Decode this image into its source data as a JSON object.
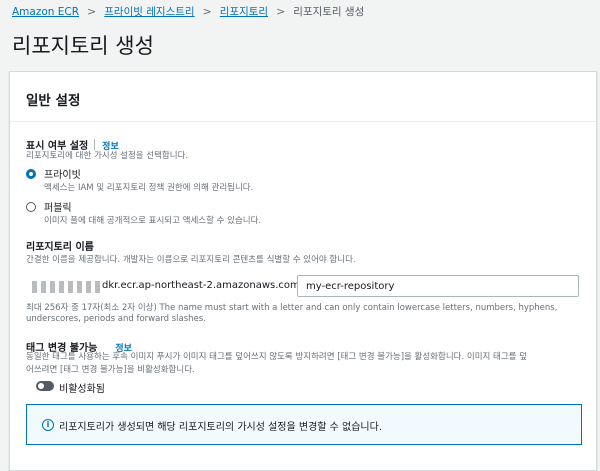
{
  "breadcrumbs": {
    "items": [
      "Amazon ECR",
      "프라이빗 레지스트리",
      "리포지토리"
    ],
    "separator": ">",
    "current": "리포지토리 생성"
  },
  "page": {
    "title": "리포지토리 생성"
  },
  "general": {
    "title": "일반 설정",
    "visibility": {
      "label": "표시 여부 설정",
      "info": "정보",
      "description": "리포지토리에 대한 가시성 설정을 선택합니다.",
      "options": [
        {
          "label": "프라이빗",
          "description": "액세스는 IAM 및 리포지토리 정책 권한에 의해 관리됩니다.",
          "selected": true
        },
        {
          "label": "퍼블릭",
          "description": "이미지 풀에 대해 공개적으로 표시되고 액세스할 수 있습니다.",
          "selected": false
        }
      ]
    },
    "repo_name": {
      "label": "리포지토리 이름",
      "description": "간결한 이름을 제공합니다. 개발자는 이름으로 리포지토리 콘텐츠를 식별할 수 있어야 합니다.",
      "prefix": "dkr.ecr.ap-northeast-2.amazonaws.com/",
      "value": "my-ecr-repository",
      "constraint_line1": "최대 256자 중 17자(최소 2자 이상) The name must start with a letter and can only contain lowercase letters, numbers, hyphens,",
      "constraint_line2": "underscores, periods and forward slashes."
    },
    "tag_immutability": {
      "label": "태그 변경 불가능",
      "info": "정보",
      "description_line1": "동일한 태그를 사용하는 후속 이미지 푸시가 이미지 태그를 덮어쓰지 않도록 방지하려면 [태그 변경 불가능]을 활성화합니다. 이미지 태그를 덮",
      "description_line2": "어쓰려면 [태그 변경 불가능]을 비활성화합니다.",
      "toggle_label": "비활성화됨",
      "enabled": false
    },
    "alert": {
      "icon": "info-icon",
      "text": "리포지토리가 생성되면 해당 리포지토리의 가시성 설정을 변경할 수 없습니다."
    }
  },
  "colors": {
    "link": "#0073bb",
    "radio_selected": "#0073bb",
    "toggle_off": "#545b64",
    "alert_border": "#0073bb",
    "alert_bg": "#f1faff"
  }
}
